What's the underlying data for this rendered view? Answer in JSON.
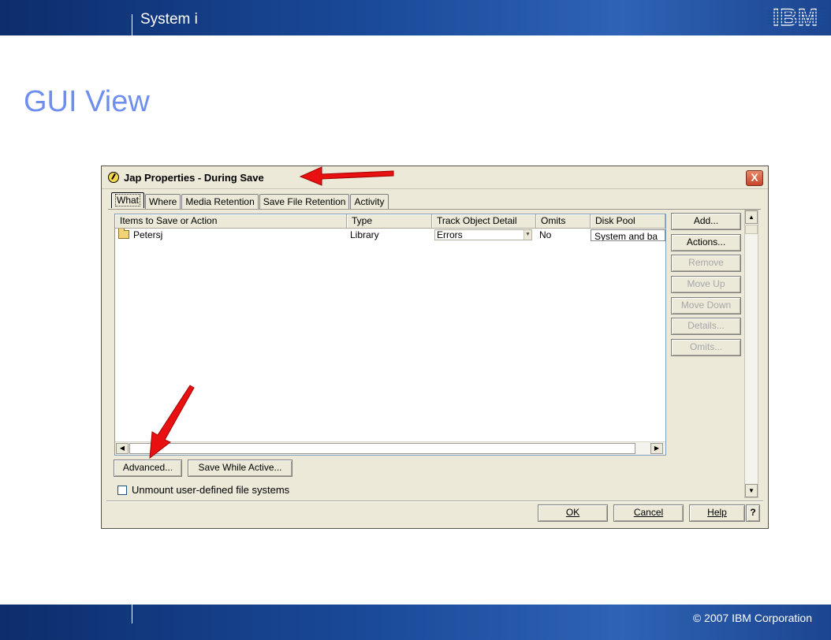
{
  "slide": {
    "product_name": "System i",
    "logo_text": "IBM",
    "title": "GUI View",
    "copyright": "© 2007 IBM Corporation"
  },
  "dialog": {
    "title": "Jap Properties - During Save",
    "close_label": "X",
    "tabs": [
      {
        "label": "What",
        "active": true
      },
      {
        "label": "Where",
        "active": false
      },
      {
        "label": "Media Retention",
        "active": false
      },
      {
        "label": "Save File Retention",
        "active": false
      },
      {
        "label": "Activity",
        "active": false
      }
    ],
    "table": {
      "columns": [
        "Items to Save or Action",
        "Type",
        "Track Object Detail",
        "Omits",
        "Disk Pool"
      ],
      "rows": [
        {
          "item": "Petersj",
          "type": "Library",
          "track": "Errors",
          "omits": "No",
          "disk_pool": "System and ba"
        }
      ]
    },
    "side_buttons": [
      {
        "label": "Add...",
        "enabled": true
      },
      {
        "label": "Actions...",
        "enabled": true
      },
      {
        "label": "Remove",
        "enabled": false
      },
      {
        "label": "Move Up",
        "enabled": false
      },
      {
        "label": "Move Down",
        "enabled": false
      },
      {
        "label": "Details...",
        "enabled": false
      },
      {
        "label": "Omits...",
        "enabled": false
      }
    ],
    "advanced_label": "Advanced...",
    "save_while_active_label": "Save While Active...",
    "unmount_label": "Unmount user-defined file systems",
    "unmount_checked": false,
    "ok_label": "OK",
    "cancel_label": "Cancel",
    "help_label": "Help",
    "context_help_label": "?"
  },
  "colors": {
    "title_blue": "#6f8ff0",
    "banner_blue": "#1a4a9a",
    "arrow_red": "#e81010"
  }
}
